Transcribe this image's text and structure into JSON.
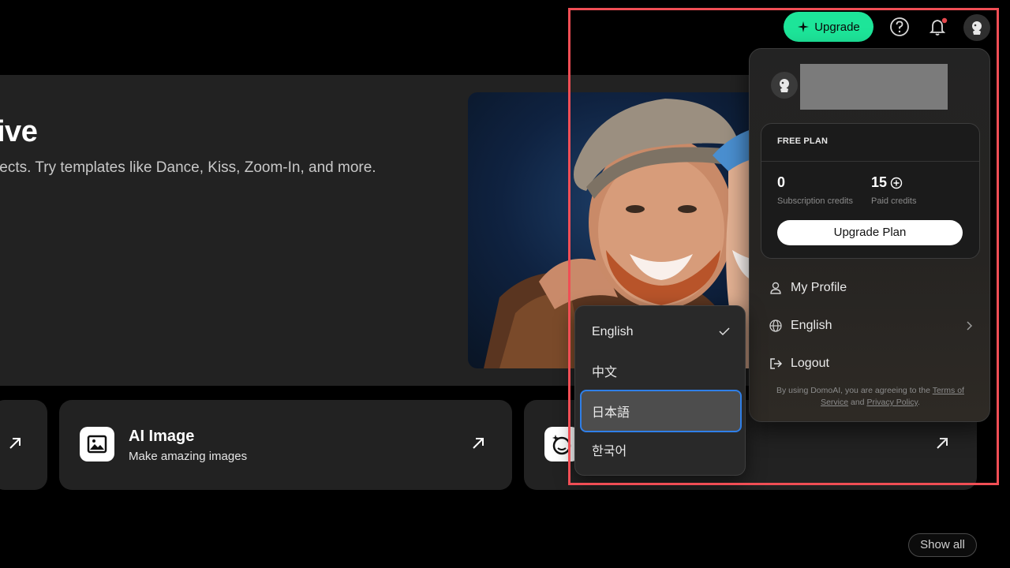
{
  "hero": {
    "title": "ive",
    "subtitle": "fects. Try templates like Dance, Kiss, Zoom-In, and more."
  },
  "cards": {
    "ai_image": {
      "title": "AI Image",
      "description": "Make amazing images"
    }
  },
  "show_all_label": "Show all",
  "topbar": {
    "upgrade_label": "Upgrade"
  },
  "account_menu": {
    "plan": {
      "name": "FREE PLAN",
      "subscription_credits": "0",
      "subscription_credits_label": "Subscription credits",
      "paid_credits": "15",
      "paid_credits_label": "Paid credits",
      "upgrade_plan_label": "Upgrade Plan"
    },
    "items": {
      "profile": "My Profile",
      "language": "English",
      "logout": "Logout"
    },
    "terms": {
      "prefix": "By using DomoAI, you are agreeing to the ",
      "terms_link": "Terms of Service",
      "and": " and ",
      "privacy_link": "Privacy Policy",
      "suffix": "."
    }
  },
  "language_menu": {
    "options": [
      "English",
      "中文",
      "日本語",
      "한국어"
    ],
    "selected": "English",
    "focused": "日本語"
  },
  "colors": {
    "accent_green": "#1de599",
    "focus_blue": "#2f7fe8",
    "highlight_red": "#f04e55",
    "notification_dot": "#e5484d"
  }
}
